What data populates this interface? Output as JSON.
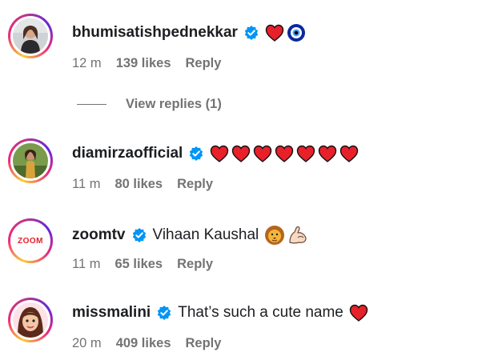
{
  "comments": [
    {
      "username": "bhumisatishpednekkar",
      "text": "",
      "time": "12 m",
      "likes": "139 likes",
      "reply": "Reply",
      "emojis": [
        "red-heart",
        "nazar-amulet"
      ],
      "view_replies": "View replies (1)"
    },
    {
      "username": "diamirzaofficial",
      "text": "",
      "time": "11 m",
      "likes": "80 likes",
      "reply": "Reply",
      "emojis": [
        "red-heart",
        "red-heart",
        "red-heart",
        "red-heart",
        "red-heart",
        "red-heart",
        "red-heart"
      ]
    },
    {
      "username": "zoomtv",
      "text": "Vihaan Kaushal",
      "time": "11 m",
      "likes": "65 likes",
      "reply": "Reply",
      "emojis": [
        "lion-face",
        "flexed-biceps"
      ],
      "avatar_logo": "ZOOM"
    },
    {
      "username": "missmalini",
      "text": "That’s such a cute name",
      "time": "20 m",
      "likes": "409 likes",
      "reply": "Reply",
      "emojis": [
        "red-heart"
      ]
    }
  ],
  "colors": {
    "text_primary": "#1c1e21",
    "text_secondary": "#737373",
    "verified_blue": "#0095f6",
    "heart_red": "#e0245e",
    "zoom_red": "#e8202a"
  }
}
